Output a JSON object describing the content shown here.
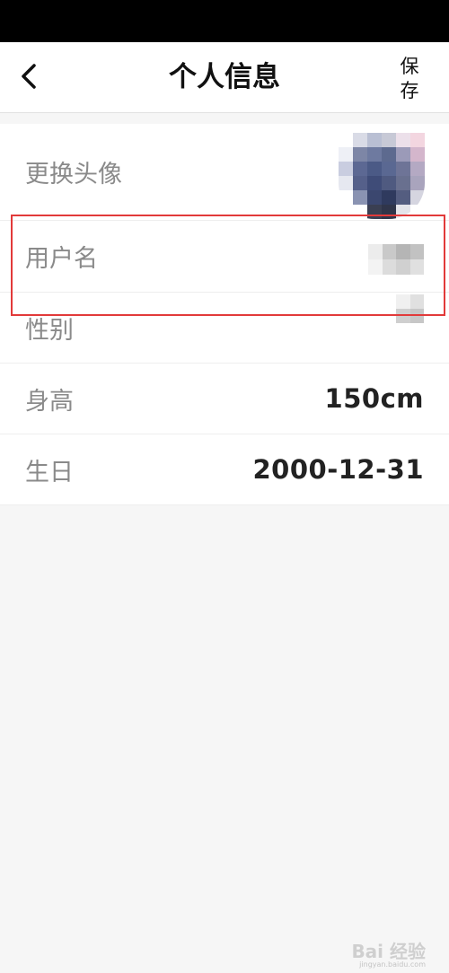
{
  "header": {
    "title": "个人信息",
    "save_label": "保存"
  },
  "rows": {
    "avatar_label": "更换头像",
    "username_label": "用户名",
    "gender_label": "性别",
    "height_label": "身高",
    "height_value": "150cm",
    "birthday_label": "生日",
    "birthday_value": "2000-12-31"
  },
  "watermark": {
    "text": "Bai 经验",
    "sub": "jingyan.baidu.com"
  },
  "colors": {
    "highlight": "#e23a3a",
    "label": "#8a8a8a",
    "value": "#222222",
    "background": "#f6f6f6"
  },
  "icons": {
    "back": "chevron-left-icon"
  }
}
